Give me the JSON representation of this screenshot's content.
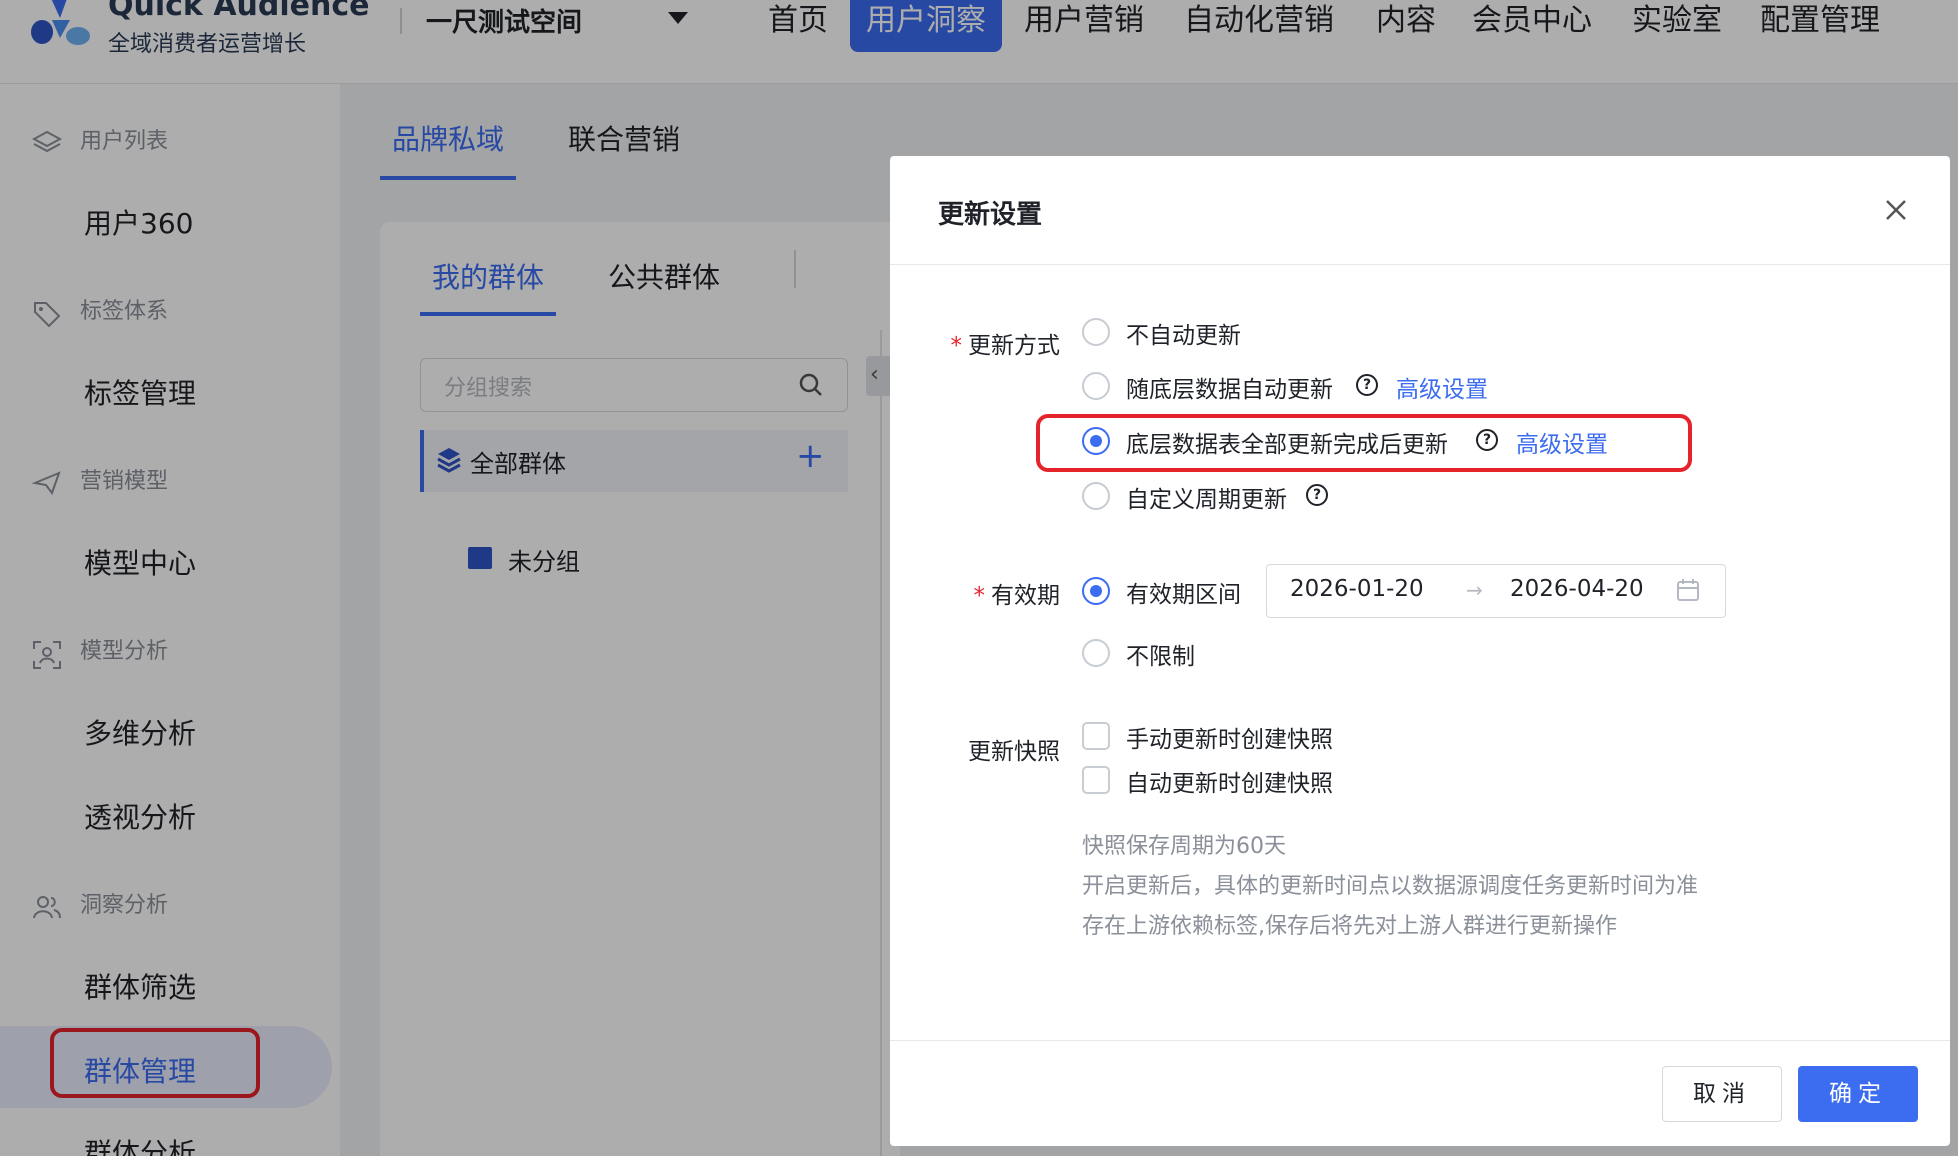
{
  "header": {
    "logo_title": "Quick Audience",
    "logo_subtitle": "全域消费者运营增长",
    "workspace": "一尺测试空间",
    "nav": [
      "首页",
      "用户洞察",
      "用户营销",
      "自动化营销",
      "内容",
      "会员中心",
      "实验室",
      "配置管理"
    ],
    "active_nav": "用户洞察"
  },
  "sidebar": {
    "groups": [
      {
        "label": "用户列表",
        "icon": "layers-icon",
        "items": [
          "用户360"
        ]
      },
      {
        "label": "标签体系",
        "icon": "tag-icon",
        "items": [
          "标签管理"
        ]
      },
      {
        "label": "营销模型",
        "icon": "send-icon",
        "items": [
          "模型中心"
        ]
      },
      {
        "label": "模型分析",
        "icon": "user-scan-icon",
        "items": [
          "多维分析",
          "透视分析"
        ]
      },
      {
        "label": "洞察分析",
        "icon": "users-icon",
        "items": [
          "群体筛选",
          "群体管理",
          "群体分析"
        ]
      }
    ],
    "active_item": "群体管理"
  },
  "content": {
    "top_tabs": [
      "品牌私域",
      "联合营销"
    ],
    "active_top_tab": "品牌私域",
    "group_tabs": [
      "我的群体",
      "公共群体"
    ],
    "active_group_tab": "我的群体",
    "search_placeholder": "分组搜索",
    "all_groups_label": "全部群体",
    "add_label": "+",
    "ungrouped_label": "未分组",
    "collapse_label": "‹"
  },
  "modal": {
    "title": "更新设置",
    "close_icon": "close-icon",
    "update_mode": {
      "label": "更新方式",
      "required": "*",
      "options": [
        {
          "label": "不自动更新",
          "selected": false
        },
        {
          "label": "随底层数据自动更新",
          "selected": false,
          "help": "?",
          "link": "高级设置"
        },
        {
          "label": "底层数据表全部更新完成后更新",
          "selected": true,
          "help": "?",
          "link": "高级设置"
        },
        {
          "label": "自定义周期更新",
          "selected": false,
          "help": "?"
        }
      ]
    },
    "validity": {
      "label": "有效期",
      "required": "*",
      "options": [
        {
          "label": "有效期区间",
          "selected": true
        },
        {
          "label": "不限制",
          "selected": false
        }
      ],
      "date_start": "2026-01-20",
      "date_arrow": "→",
      "date_end": "2026-04-20"
    },
    "snapshot": {
      "label": "更新快照",
      "options": [
        {
          "label": "手动更新时创建快照",
          "checked": false
        },
        {
          "label": "自动更新时创建快照",
          "checked": false
        }
      ]
    },
    "notes": [
      "快照保存周期为60天",
      "开启更新后，具体的更新时间点以数据源调度任务更新时间为准",
      "存在上游依赖标签,保存后将先对上游人群进行更新操作"
    ],
    "cancel_label": "取消",
    "ok_label": "确定"
  },
  "colors": {
    "accent": "#3c6cf0",
    "highlight_red": "#e5232b",
    "overlay": "rgba(0,0,0,0.32)"
  }
}
